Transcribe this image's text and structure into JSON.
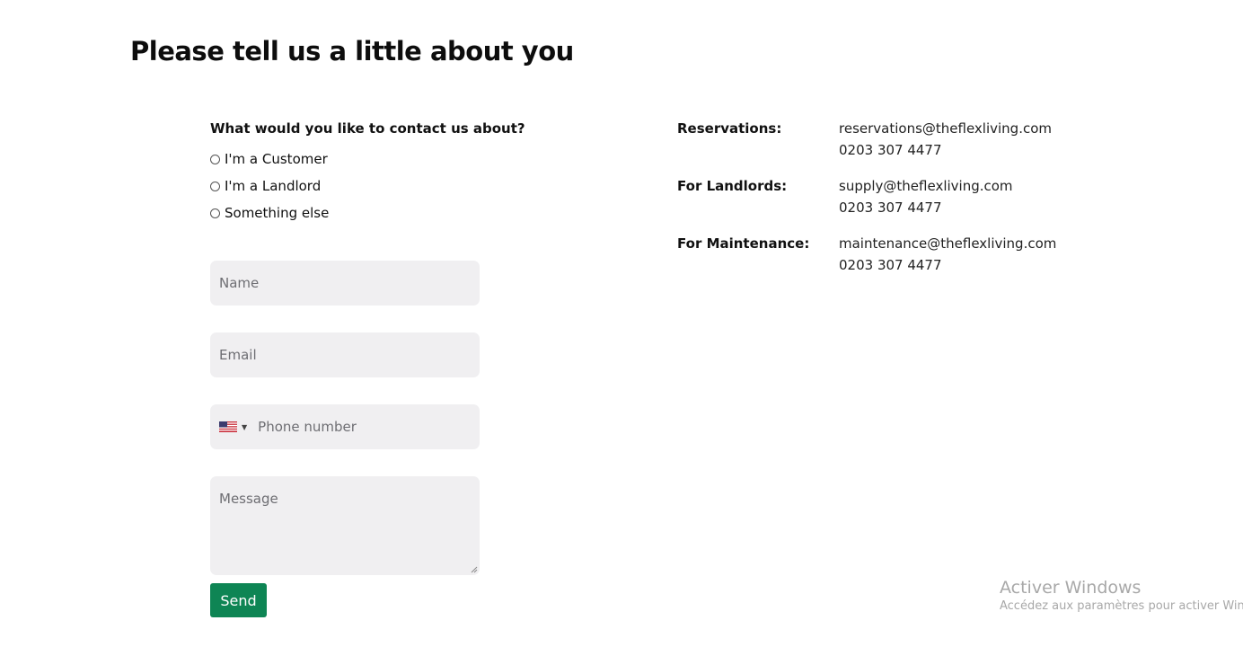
{
  "page": {
    "title": "Please tell us a little about you"
  },
  "form": {
    "question": "What would you like to contact us about?",
    "radio_options": [
      {
        "label": "I'm a Customer",
        "selected": false
      },
      {
        "label": "I'm a Landlord",
        "selected": false
      },
      {
        "label": "Something else",
        "selected": false
      }
    ],
    "name_placeholder": "Name",
    "email_placeholder": "Email",
    "phone": {
      "country_flag": "us-flag-icon",
      "placeholder": "Phone number"
    },
    "message_placeholder": "Message",
    "send_label": "Send",
    "send_color": "#0e8554",
    "field_background": "#f0eff1"
  },
  "contacts": [
    {
      "label": "Reservations:",
      "email": "reservations@theflexliving.com",
      "phone": "0203 307 4477"
    },
    {
      "label": "For Landlords:",
      "email": "supply@theflexliving.com",
      "phone": "0203 307 4477"
    },
    {
      "label": "For Maintenance:",
      "email": "maintenance@theflexliving.com",
      "phone": "0203 307 4477"
    }
  ],
  "watermark": {
    "title": "Activer Windows",
    "subtitle": "Accédez aux paramètres pour activer Windows."
  }
}
